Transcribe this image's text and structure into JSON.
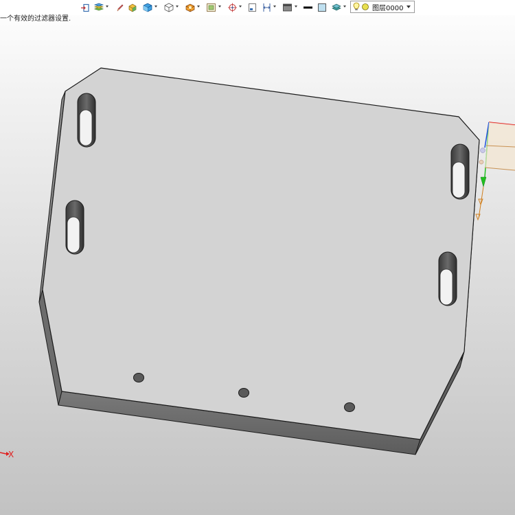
{
  "app": {
    "status_message": "一个有效的过滤器设置."
  },
  "toolbar": {
    "icons": [
      "import-icon",
      "layer-filter-icon",
      "pen-sketch-icon",
      "solid-shade-icon",
      "view-cube-icon",
      "wireframe-box-icon",
      "render-mode-icon",
      "fit-view-icon",
      "snap-target-icon",
      "sheet-view-icon",
      "dimension-icon",
      "display-style-icon",
      "line-color-icon",
      "fill-color-icon",
      "layer-stack-icon"
    ],
    "layer_select": {
      "value": "图层0000",
      "icons": [
        "bulb-icon",
        "layer-color-icon"
      ]
    }
  },
  "viewport": {
    "axis_label_x": "X",
    "colors": {
      "plate_top": "#d3d3d3",
      "plate_side": "#6f6f6f",
      "edge": "#1a1a1a",
      "axis_x": "#e02020",
      "axis_y": "#20c020",
      "axis_z": "#2050e0"
    }
  }
}
